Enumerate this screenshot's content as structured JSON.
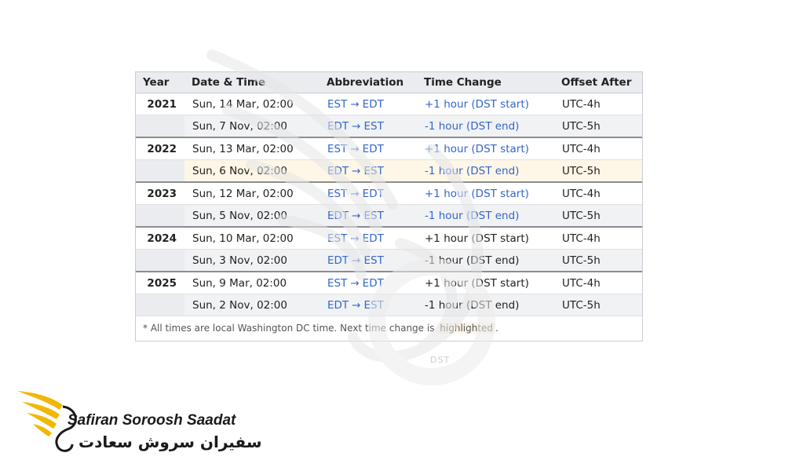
{
  "table": {
    "headers": {
      "year": "Year",
      "date": "Date & Time",
      "abbr": "Abbreviation",
      "change": "Time Change",
      "offset": "Offset After"
    },
    "rows": [
      {
        "year": "2021",
        "date": "Sun, 14 Mar, 02:00",
        "abbr_from": "EST",
        "abbr_to": "EDT",
        "change": "+1 hour (DST start)",
        "offset": "UTC-4h"
      },
      {
        "year": "",
        "date": "Sun, 7 Nov, 02:00",
        "abbr_from": "EDT",
        "abbr_to": "EST",
        "change": "-1 hour (DST end)",
        "offset": "UTC-5h"
      },
      {
        "year": "2022",
        "date": "Sun, 13 Mar, 02:00",
        "abbr_from": "EST",
        "abbr_to": "EDT",
        "change": "+1 hour (DST start)",
        "offset": "UTC-4h"
      },
      {
        "year": "",
        "date": "Sun, 6 Nov, 02:00",
        "abbr_from": "EDT",
        "abbr_to": "EST",
        "change": "-1 hour (DST end)",
        "offset": "UTC-5h"
      },
      {
        "year": "2023",
        "date": "Sun, 12 Mar, 02:00",
        "abbr_from": "EST",
        "abbr_to": "EDT",
        "change": "+1 hour (DST start)",
        "offset": "UTC-4h"
      },
      {
        "year": "",
        "date": "Sun, 5 Nov, 02:00",
        "abbr_from": "EDT",
        "abbr_to": "EST",
        "change": "-1 hour (DST end)",
        "offset": "UTC-5h"
      },
      {
        "year": "2024",
        "date": "Sun, 10 Mar, 02:00",
        "abbr_from": "EST",
        "abbr_to": "EDT",
        "change": "+1 hour (DST start)",
        "offset": "UTC-4h"
      },
      {
        "year": "",
        "date": "Sun, 3 Nov, 02:00",
        "abbr_from": "EDT",
        "abbr_to": "EST",
        "change": "-1 hour (DST end)",
        "offset": "UTC-5h"
      },
      {
        "year": "2025",
        "date": "Sun, 9 Mar, 02:00",
        "abbr_from": "EST",
        "abbr_to": "EDT",
        "change": "+1 hour (DST start)",
        "offset": "UTC-4h"
      },
      {
        "year": "",
        "date": "Sun, 2 Nov, 02:00",
        "abbr_from": "EDT",
        "abbr_to": "EST",
        "change": "-1 hour (DST end)",
        "offset": "UTC-5h"
      }
    ],
    "arrow": "→",
    "footnote_prefix": "* All times are local Washington DC time. Next time change is",
    "footnote_highlight": "highlighted",
    "footnote_suffix": "."
  },
  "watermark_text": "DST",
  "logo": {
    "latin": "Safiran Soroosh Saadat",
    "persian": "سفیران سروش سعادت",
    "colors": {
      "wing": "#f2b705",
      "text": "#1a1a1a"
    }
  },
  "colors": {
    "link": "#3366cc",
    "header_bg": "#eaecf0",
    "highlight": "#fef6e6"
  }
}
